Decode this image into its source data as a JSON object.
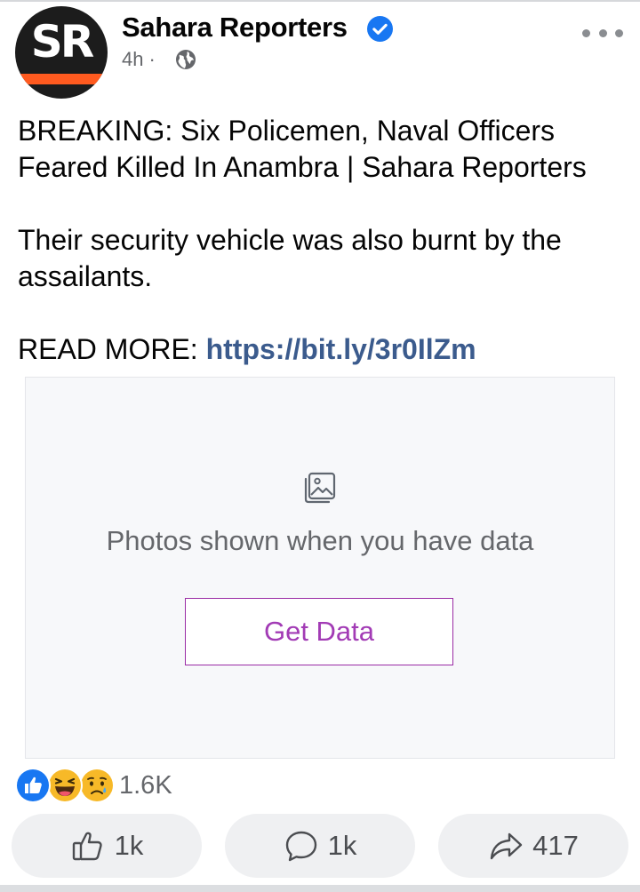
{
  "header": {
    "avatar_text": "SR",
    "page_name": "Sahara Reporters",
    "time": "4h",
    "separator": "·"
  },
  "post": {
    "line1": "BREAKING: Six Policemen, Naval Officers Feared Killed In Anambra | Sahara Reporters",
    "line2": "Their security vehicle was also burnt by the assailants.",
    "read_more_label": "READ MORE: ",
    "link": "https://bit.ly/3r0IlZm"
  },
  "media": {
    "message": "Photos shown when you have data",
    "button_label": "Get Data"
  },
  "reactions": {
    "types": [
      "like-icon",
      "haha-icon",
      "sad-icon"
    ],
    "count": "1.6K"
  },
  "actions": {
    "like_count": "1k",
    "comment_count": "1k",
    "share_count": "417"
  },
  "colors": {
    "link": "#3b5b8d",
    "accent_purple": "#a23bb5",
    "verified_blue": "#1877f2",
    "avatar_orange": "#ff5a1f"
  }
}
